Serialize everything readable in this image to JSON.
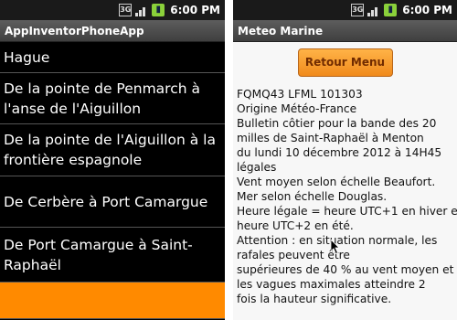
{
  "status_bar": {
    "network": "3G",
    "battery_icon": "battery-icon",
    "time": "6:00 PM"
  },
  "left_screen": {
    "title": "AppInventorPhoneApp",
    "items": [
      {
        "label": "Hague",
        "selected": false
      },
      {
        "label": "De la pointe de Penmarch à l'anse de l'Aiguillon",
        "selected": false
      },
      {
        "label": "De la pointe de l'Aiguillon à la frontière espagnole",
        "selected": false
      },
      {
        "label": "De Cerbère à Port Camargue",
        "selected": false
      },
      {
        "label": "De Port Camargue à Saint-Raphaël",
        "selected": false
      },
      {
        "label": "",
        "selected": true
      }
    ],
    "highlight_color": "#ff8a00"
  },
  "right_screen": {
    "title": "Meteo Marine",
    "button_label": "Retour Menu",
    "bulletin_lines": [
      "FQMQ43 LFML 101303",
      "Origine Météo-France",
      "Bulletin côtier pour la bande des 20",
      "milles de Saint-Raphaël à Menton",
      "du lundi 10 décembre 2012 à 14H45",
      "légales",
      "Vent moyen selon échelle Beaufort.",
      "Mer selon échelle Douglas.",
      "Heure légale = heure UTC+1 en hiver et",
      "heure UTC+2 en été.",
      "Attention : en situation normale, les",
      "rafales peuvent être",
      "supérieures de 40 % au vent moyen et",
      "les vagues maximales atteindre 2",
      "fois la hauteur significative."
    ]
  }
}
